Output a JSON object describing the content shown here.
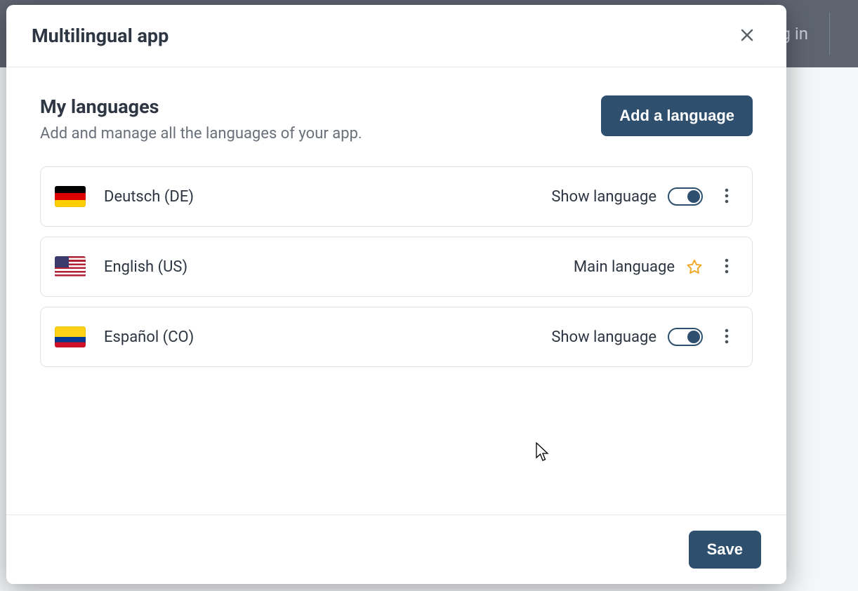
{
  "background": {
    "header_right_text": "g in"
  },
  "modal": {
    "title": "Multilingual app",
    "section_title": "My languages",
    "section_subtitle": "Add and manage all the languages of your app.",
    "add_button_label": "Add a language",
    "save_button_label": "Save",
    "labels": {
      "show_language": "Show language",
      "main_language": "Main language"
    },
    "languages": [
      {
        "name": "Deutsch (DE)",
        "flag": "de",
        "status": "show",
        "toggle_on": true
      },
      {
        "name": "English (US)",
        "flag": "us",
        "status": "main"
      },
      {
        "name": "Español (CO)",
        "flag": "co",
        "status": "show",
        "toggle_on": true
      }
    ]
  },
  "colors": {
    "primary": "#2e4f6e",
    "text": "#2d3642",
    "muted": "#6a707a",
    "border": "#dfe2e8",
    "star": "#f0a92a"
  }
}
